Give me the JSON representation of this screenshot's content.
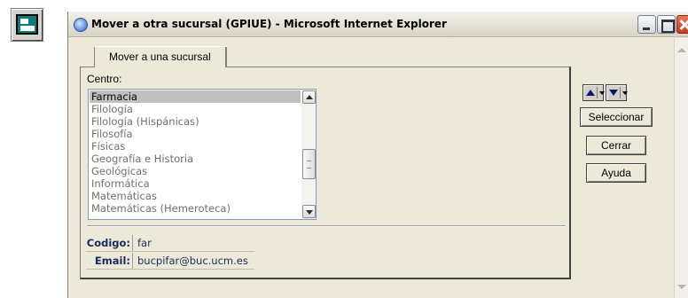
{
  "window": {
    "title": "Mover a otra sucursal (GPIUE) - Microsoft Internet Explorer"
  },
  "tab": {
    "label": "Mover a una sucursal"
  },
  "centro": {
    "label": "Centro:",
    "items": [
      "Farmacia",
      "Filología",
      "Filología (Hispánicas)",
      "Filosofía",
      "Físicas",
      "Geografía e Historia",
      "Geológicas",
      "Informática",
      "Matemáticas",
      "Matemáticas (Hemeroteca)"
    ],
    "selected": "Farmacia"
  },
  "details": {
    "codigo_label": "Codigo:",
    "codigo_value": "far",
    "email_label": "Email:",
    "email_value": "bucpifar@buc.ucm.es"
  },
  "buttons": {
    "seleccionar": "Seleccionar",
    "cerrar": "Cerrar",
    "ayuda": "Ayuda"
  }
}
